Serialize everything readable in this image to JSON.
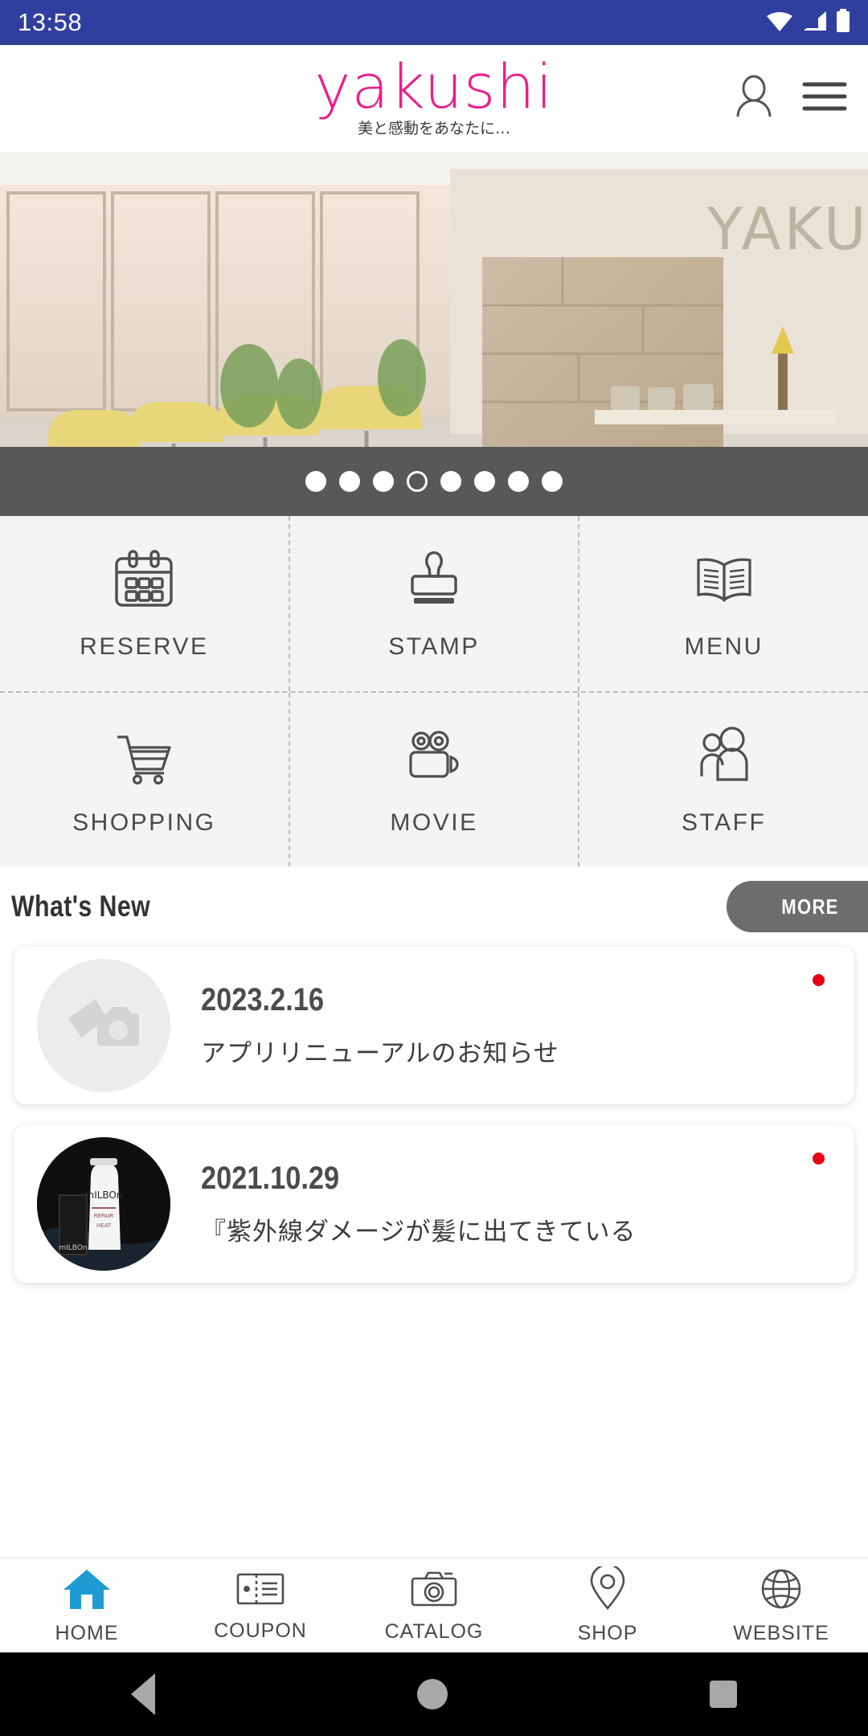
{
  "status_bar": {
    "time": "13:58",
    "icons": [
      "wifi-icon",
      "signal-icon",
      "battery-icon"
    ]
  },
  "header": {
    "logo_text": "yakushi",
    "logo_tagline": "美と感動をあなたに…",
    "logo_color": "#ec1e8c",
    "account_icon": "person-icon",
    "menu_icon": "hamburger-menu-icon"
  },
  "carousel": {
    "total_slides": 8,
    "active_index": 3,
    "alt": "salon interior with yellow styling chairs",
    "bar_color": "#595757"
  },
  "grid": {
    "rows": [
      [
        {
          "label": "RESERVE",
          "icon": "calendar-icon"
        },
        {
          "label": "STAMP",
          "icon": "stamp-icon"
        },
        {
          "label": "MENU",
          "icon": "open-book-icon"
        }
      ],
      [
        {
          "label": "SHOPPING",
          "icon": "shopping-cart-icon"
        },
        {
          "label": "MOVIE",
          "icon": "movie-camera-icon"
        },
        {
          "label": "STAFF",
          "icon": "people-icon"
        }
      ]
    ]
  },
  "news": {
    "title": "What's New",
    "more_label": "MORE",
    "items": [
      {
        "date": "2023.2.16",
        "text": "アプリリニューアルのお知らせ",
        "thumb": "photo-placeholder-icon",
        "unread": true
      },
      {
        "date": "2021.10.29",
        "text": "『紫外線ダメージが髪に出てきている",
        "thumb": "milbon-product-photo",
        "unread": true
      }
    ]
  },
  "tab_bar": {
    "active": "HOME",
    "active_color": "#1f9bd4",
    "items": [
      {
        "label": "HOME",
        "icon": "home-icon"
      },
      {
        "label": "COUPON",
        "icon": "ticket-icon"
      },
      {
        "label": "CATALOG",
        "icon": "camera-icon"
      },
      {
        "label": "SHOP",
        "icon": "map-pin-icon"
      },
      {
        "label": "WEBSITE",
        "icon": "globe-icon"
      }
    ]
  },
  "system_nav": {
    "back": "back-triangle-icon",
    "home": "home-circle-icon",
    "recents": "recents-square-icon"
  }
}
